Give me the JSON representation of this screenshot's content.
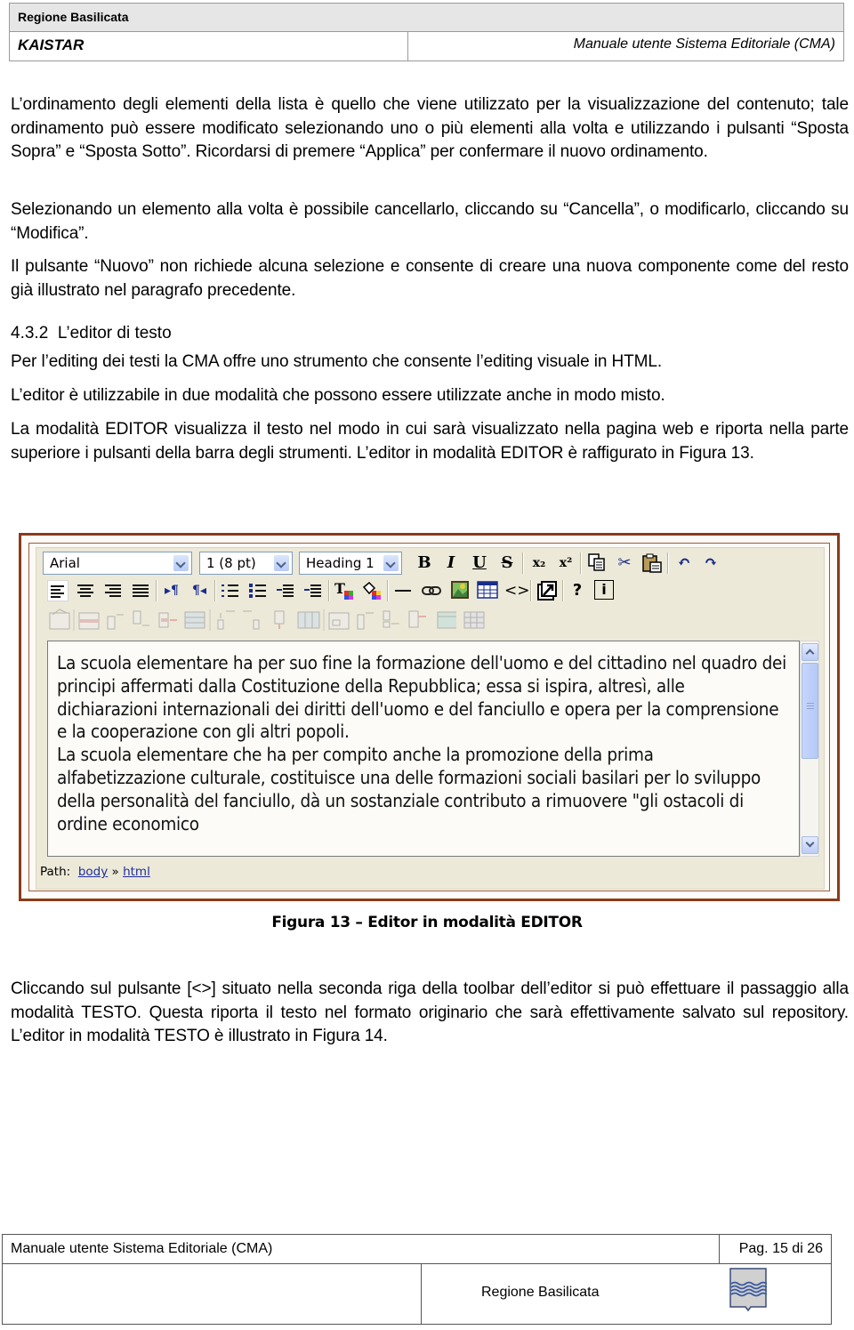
{
  "header": {
    "org": "Regione Basilicata",
    "company": "KAISTAR",
    "doc_title": "Manuale utente Sistema Editoriale (CMA)"
  },
  "paragraphs": {
    "p1": "L’ordinamento degli elementi della lista è quello che viene utilizzato per la visualizzazione del contenuto; tale ordinamento può essere modificato selezionando uno o più elementi alla volta e utilizzando i pulsanti “Sposta Sopra” e “Sposta Sotto”. Ricordarsi di premere “Applica” per confermare il nuovo ordinamento.",
    "p2": "Selezionando un elemento alla volta è possibile cancellarlo, cliccando su “Cancella”, o modificarlo, cliccando su “Modifica”.",
    "p3": "Il pulsante “Nuovo” non richiede alcuna selezione e consente di creare una nuova componente come del resto già illustrato nel paragrafo precedente.",
    "section_number": "4.3.2",
    "section_title": "L’editor di testo",
    "p4": "Per l’editing dei testi la CMA offre uno strumento che consente l’editing visuale in HTML.",
    "p5": "L’editor è utilizzabile in due modalità che possono essere utilizzate anche in modo misto.",
    "p6": "La modalità EDITOR visualizza il testo nel modo in cui sarà visualizzato nella pagina web e riporta nella parte superiore i pulsanti della barra degli strumenti. L’editor in modalità EDITOR è raffigurato in Figura 13.",
    "p7": "Cliccando sul pulsante [<>] situato nella seconda riga della toolbar dell’editor si può effettuare il passaggio alla modalità TESTO. Questa riporta il testo nel formato originario che sarà effettivamente salvato sul repository. L’editor in modalità TESTO è illustrato in Figura 14."
  },
  "editor": {
    "font_select": "Arial",
    "size_select": "1 (8 pt)",
    "format_select": "Heading 1",
    "toolbar_row1": [
      {
        "icon": "bold-icon",
        "glyph": "B"
      },
      {
        "icon": "italic-icon",
        "glyph": "I"
      },
      {
        "icon": "underline-icon",
        "glyph": "U"
      },
      {
        "icon": "strikethrough-icon",
        "glyph": "S"
      },
      {
        "icon": "subscript-icon",
        "glyph": "x₂"
      },
      {
        "icon": "superscript-icon",
        "glyph": "x²"
      },
      {
        "icon": "copy-icon",
        "glyph": ""
      },
      {
        "icon": "cut-icon",
        "glyph": "✂"
      },
      {
        "icon": "paste-icon",
        "glyph": ""
      },
      {
        "icon": "undo-icon",
        "glyph": "↶"
      },
      {
        "icon": "redo-icon",
        "glyph": "↷"
      }
    ],
    "toolbar_row2": [
      "align-left-icon",
      "align-center-icon",
      "align-right-icon",
      "align-justify-icon",
      "ltr-icon",
      "rtl-icon",
      "ordered-list-icon",
      "unordered-list-icon",
      "outdent-icon",
      "indent-icon",
      "text-color-icon",
      "background-color-icon",
      "horizontal-rule-icon",
      "link-icon",
      "image-icon",
      "table-icon",
      "html-source-icon",
      "popup-editor-icon",
      "help-icon",
      "about-icon"
    ],
    "source_glyph": "<>",
    "help_glyph": "?",
    "about_glyph": "i",
    "ltr_glyph": "▸¶",
    "rtl_glyph": "¶◂",
    "content": [
      "La scuola elementare ha per suo fine la formazione dell'uomo e del cittadino nel quadro dei principi affermati dalla Costituzione della Repubblica; essa si ispira, altresì, alle dichiarazioni internazionali dei diritti dell'uomo e del fanciullo e opera per la comprensione e la cooperazione con gli altri popoli.",
      "La scuola elementare che ha per compito anche la promozione della prima alfabetizzazione culturale, costituisce una delle formazioni sociali basilari per lo sviluppo della personalità del fanciullo, dà un sostanziale contributo a rimuovere \"gli ostacoli di ordine economico"
    ],
    "path_label": "Path:",
    "path_items": [
      "body",
      "html"
    ],
    "path_separator": "»",
    "scroll_position": 0.0
  },
  "figure": {
    "caption": "Figura 13 – Editor in modalità EDITOR"
  },
  "footer": {
    "doc_title": "Manuale utente Sistema Editoriale (CMA)",
    "page": "Pag. 15 di 26",
    "org": "Regione Basilicata"
  }
}
